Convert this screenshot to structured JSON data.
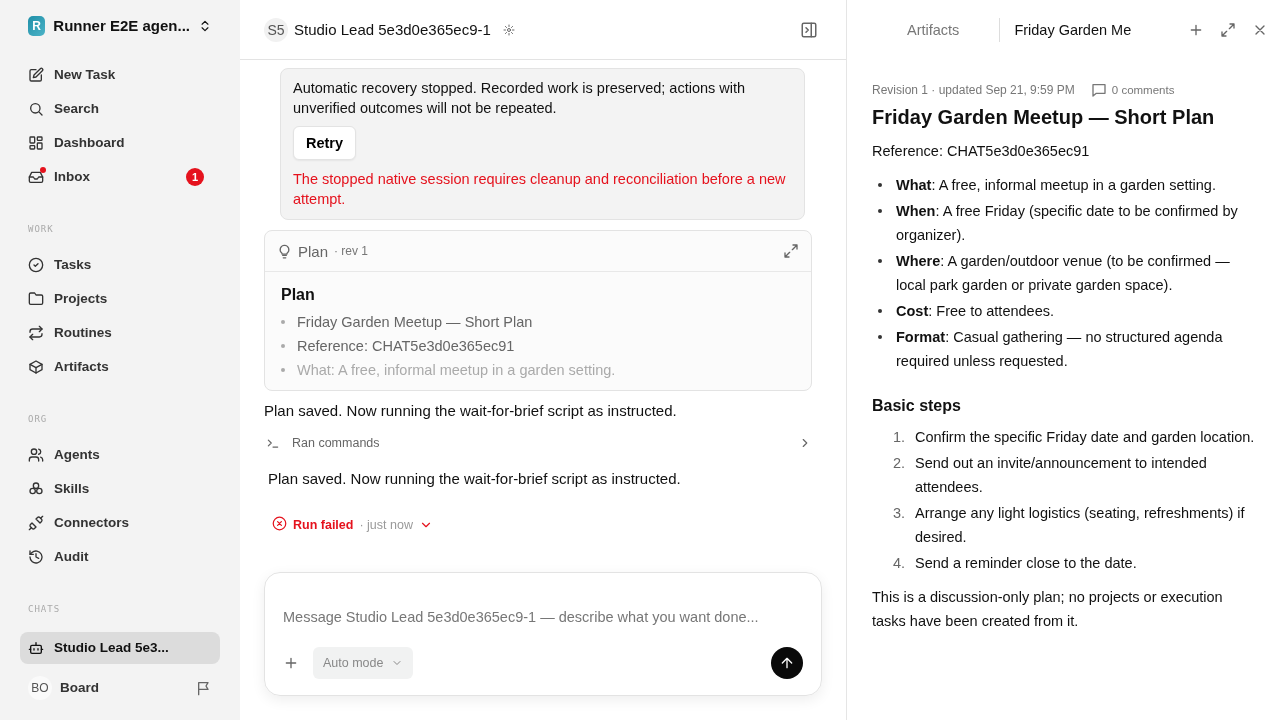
{
  "workspace": {
    "logo": "R",
    "name": "Runner E2E agen..."
  },
  "nav": [
    {
      "label": "New Task",
      "selected": false
    },
    {
      "label": "Search",
      "selected": false
    },
    {
      "label": "Dashboard",
      "selected": false
    },
    {
      "label": "Inbox",
      "selected": false,
      "badge": "1",
      "unread": true
    }
  ],
  "sections": [
    {
      "heading": "WORK",
      "items": [
        {
          "label": "Tasks",
          "selected": false
        },
        {
          "label": "Projects",
          "selected": false
        },
        {
          "label": "Routines",
          "selected": false
        },
        {
          "label": "Artifacts",
          "selected": false
        }
      ]
    },
    {
      "heading": "ORG",
      "items": [
        {
          "label": "Agents",
          "selected": false
        },
        {
          "label": "Skills",
          "selected": false
        },
        {
          "label": "Connectors",
          "selected": false
        },
        {
          "label": "Audit",
          "selected": false
        }
      ]
    },
    {
      "heading": "CHATS",
      "items": [
        {
          "label": "Studio Lead 5e3...",
          "selected": true
        }
      ]
    }
  ],
  "user": {
    "initials": "BO",
    "name": "Board"
  },
  "header": {
    "avatar": "S5",
    "title": "Studio Lead 5e3d0e365ec9-1"
  },
  "notice": {
    "text": "Automatic recovery stopped. Recorded work is preserved; actions with unverified outcomes will not be repeated.",
    "button": "Retry",
    "error": "The stopped native session requires cleanup and reconciliation before a new attempt."
  },
  "plan_card": {
    "title": "Plan",
    "rev": "· rev 1",
    "heading": "Plan",
    "items": [
      "Friday Garden Meetup — Short Plan",
      "Reference: CHAT5e3d0e365ec91",
      "What: A free, informal meetup in a garden setting."
    ]
  },
  "messages": [
    {
      "kind": "text",
      "text": "Plan saved. Now running the wait-for-brief script as instructed."
    },
    {
      "kind": "tool",
      "text": "Ran commands"
    },
    {
      "kind": "text",
      "text": "Plan saved. Now running the wait-for-brief script as instructed."
    },
    {
      "kind": "status",
      "text": "Run failed",
      "time": "· just now"
    }
  ],
  "composer": {
    "placeholder": "Message Studio Lead 5e3d0e365ec9-1 — describe what you want done...",
    "mode": "Auto mode"
  },
  "panel": {
    "tabs": [
      {
        "label": "Artifacts",
        "selected": false
      },
      {
        "label": "Friday Garden Me",
        "selected": true
      }
    ],
    "meta": "Revision 1 · updated Sep 21, 9:59 PM",
    "comments": "0 comments",
    "title": "Friday Garden Meetup — Short Plan",
    "reference": "Reference: CHAT5e3d0e365ec91",
    "bullets": [
      "**What**: A free, informal meetup in a garden setting.",
      "**When**: A free Friday (specific date to be confirmed by organizer).",
      "**Where**: A garden/outdoor venue (to be confirmed — local park garden or private garden space).",
      "**Cost**: Free to attendees.",
      "**Format**: Casual gathering — no structured agenda required unless requested."
    ],
    "steps_heading": "Basic steps",
    "steps": [
      {
        "number": "1.",
        "text": "Confirm the specific Friday date and garden location."
      },
      {
        "number": "2.",
        "text": "Send out an invite/announcement to intended attendees."
      },
      {
        "number": "3.",
        "text": "Arrange any light logistics (seating, refreshments) if desired."
      },
      {
        "number": "4.",
        "text": "Send a reminder close to the date."
      }
    ],
    "footer": "This is a discussion-only plan; no projects or execution tasks have been created from it."
  }
}
